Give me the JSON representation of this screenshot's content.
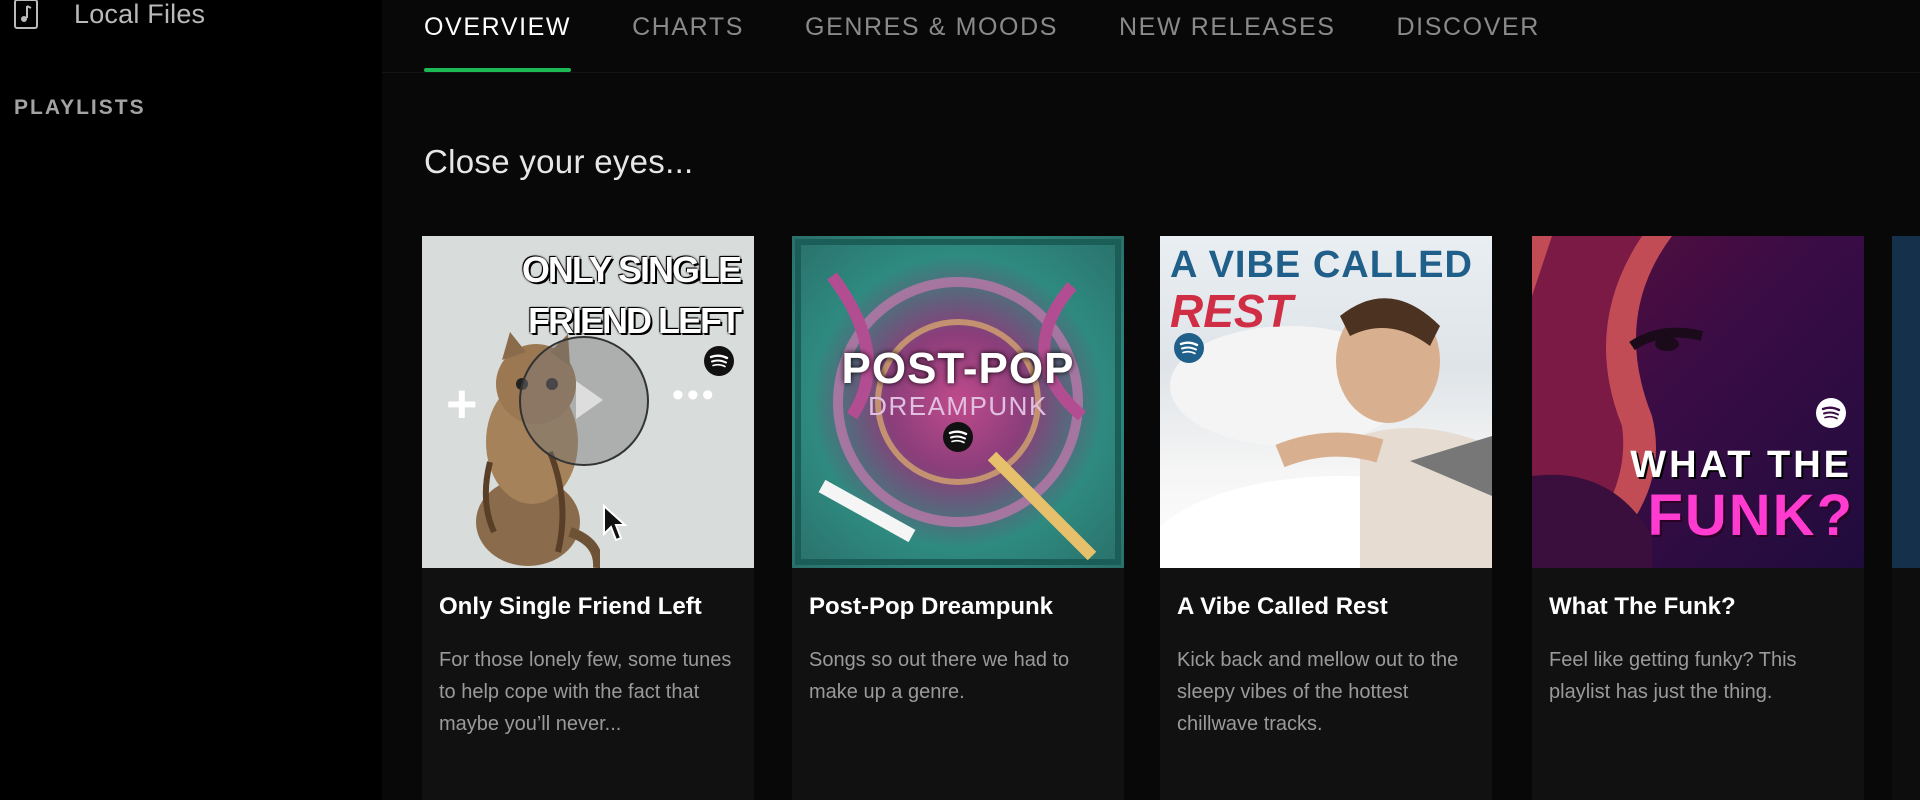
{
  "sidebar": {
    "local_files_label": "Local Files",
    "playlists_heading": "PLAYLISTS"
  },
  "tabs": [
    {
      "label": "OVERVIEW",
      "active": true
    },
    {
      "label": "CHARTS",
      "active": false
    },
    {
      "label": "GENRES & MOODS",
      "active": false
    },
    {
      "label": "NEW RELEASES",
      "active": false
    },
    {
      "label": "DISCOVER",
      "active": false
    }
  ],
  "section": {
    "title": "Close your eyes..."
  },
  "cards": [
    {
      "title": "Only Single Friend Left",
      "description": "For those lonely few, some tunes to help cope with the fact that maybe you’ll never...",
      "cover_text_lines": [
        "ONLY SINGLE",
        "FRIEND LEFT"
      ]
    },
    {
      "title": "Post-Pop Dreampunk",
      "description": "Songs so out there we had to make up a genre.",
      "cover_text_lines": [
        "POST-POP",
        "DREAMPUNK"
      ]
    },
    {
      "title": "A Vibe Called Rest",
      "description": "Kick back and mellow out to the sleepy vibes of the hottest chillwave tracks.",
      "cover_text_lines": [
        "A VIBE CALLED",
        "REST"
      ]
    },
    {
      "title": "What The Funk?",
      "description": "Feel like getting funky? This playlist has just the thing.",
      "cover_text_lines": [
        "WHAT THE",
        "FUNK?"
      ]
    }
  ],
  "hover_overlay": {
    "add_symbol": "+",
    "more_symbol": "•••"
  },
  "colors": {
    "accent": "#1db954",
    "background": "#070707",
    "sidebar": "#000000"
  },
  "icons": [
    "music-note-icon",
    "add-icon",
    "play-icon",
    "more-icon",
    "spotify-logo-icon",
    "cursor-icon"
  ]
}
